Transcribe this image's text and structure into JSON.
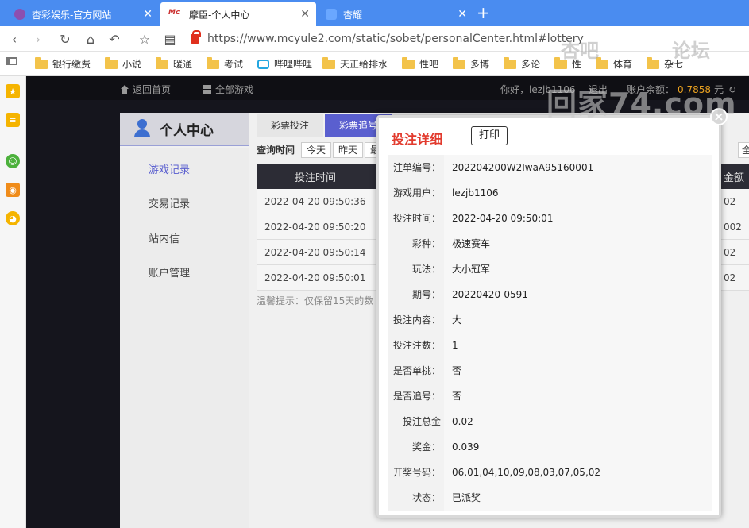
{
  "browser": {
    "tabs": [
      {
        "title": "杏彩娱乐-官方网站",
        "active": false
      },
      {
        "title": "摩臣-个人中心",
        "active": true
      },
      {
        "title": "杏耀",
        "active": false
      }
    ],
    "url": "https://www.mcyule2.com/static/sobet/personalCenter.html#lottery",
    "bookmarks": [
      "银行缴费",
      "小说",
      "暖通",
      "考试",
      "哔哩哔哩",
      "天正给排水",
      "性吧",
      "多博",
      "多论",
      "性",
      "体育",
      "杂七"
    ]
  },
  "topnav": {
    "home": "返回首页",
    "all_games": "全部游戏",
    "greeting": "你好，lezjb1106",
    "logout": "退出",
    "balance_label": "账户余额：",
    "balance_value": "0.7858",
    "balance_unit": "元"
  },
  "personal_center": {
    "title": "个人中心",
    "menu": [
      "游戏记录",
      "交易记录",
      "站内信",
      "账户管理"
    ],
    "tabs": [
      "彩票投注",
      "彩票追号"
    ],
    "filter_label": "查询时间",
    "filter_buttons": [
      "今天",
      "昨天",
      "最"
    ],
    "table_header": "投注时间",
    "table_header_right": "金额",
    "table_rows": [
      {
        "time": "2022-04-20 09:50:36",
        "amount": "02"
      },
      {
        "time": "2022-04-20 09:50:20",
        "amount": "002"
      },
      {
        "time": "2022-04-20 09:50:14",
        "amount": "02"
      },
      {
        "time": "2022-04-20 09:50:01",
        "amount": "02"
      }
    ],
    "tip": "温馨提示：仅保留15天的数"
  },
  "modal": {
    "title": "投注详细",
    "print": "打印",
    "rows": [
      {
        "label": "注单编号：",
        "value": "202204200W2IwaA95160001"
      },
      {
        "label": "游戏用户：",
        "value": "lezjb1106"
      },
      {
        "label": "投注时间：",
        "value": "2022-04-20 09:50:01"
      },
      {
        "label": "彩种：",
        "value": "极速赛车"
      },
      {
        "label": "玩法：",
        "value": "大小冠军"
      },
      {
        "label": "期号：",
        "value": "20220420-0591"
      },
      {
        "label": "投注内容：",
        "value": "大"
      },
      {
        "label": "投注注数：",
        "value": "1"
      },
      {
        "label": "是否单挑：",
        "value": "否"
      },
      {
        "label": "是否追号：",
        "value": "否"
      },
      {
        "label": "投注总金额：",
        "value": "0.02"
      },
      {
        "label": "奖金：",
        "value": "0.039"
      },
      {
        "label": "开奖号码：",
        "value": "06,01,04,10,09,08,03,07,05,02"
      },
      {
        "label": "状态：",
        "value": "已派奖"
      }
    ]
  },
  "watermark": {
    "line1": "杏吧",
    "line2": "论坛",
    "line3": "回家74.com"
  },
  "colors": {
    "tabbar": "#4a8cf0",
    "modal_title": "#e23b2e",
    "menu_active": "#5a5fcf",
    "tab_active": "#5a5fcf"
  }
}
